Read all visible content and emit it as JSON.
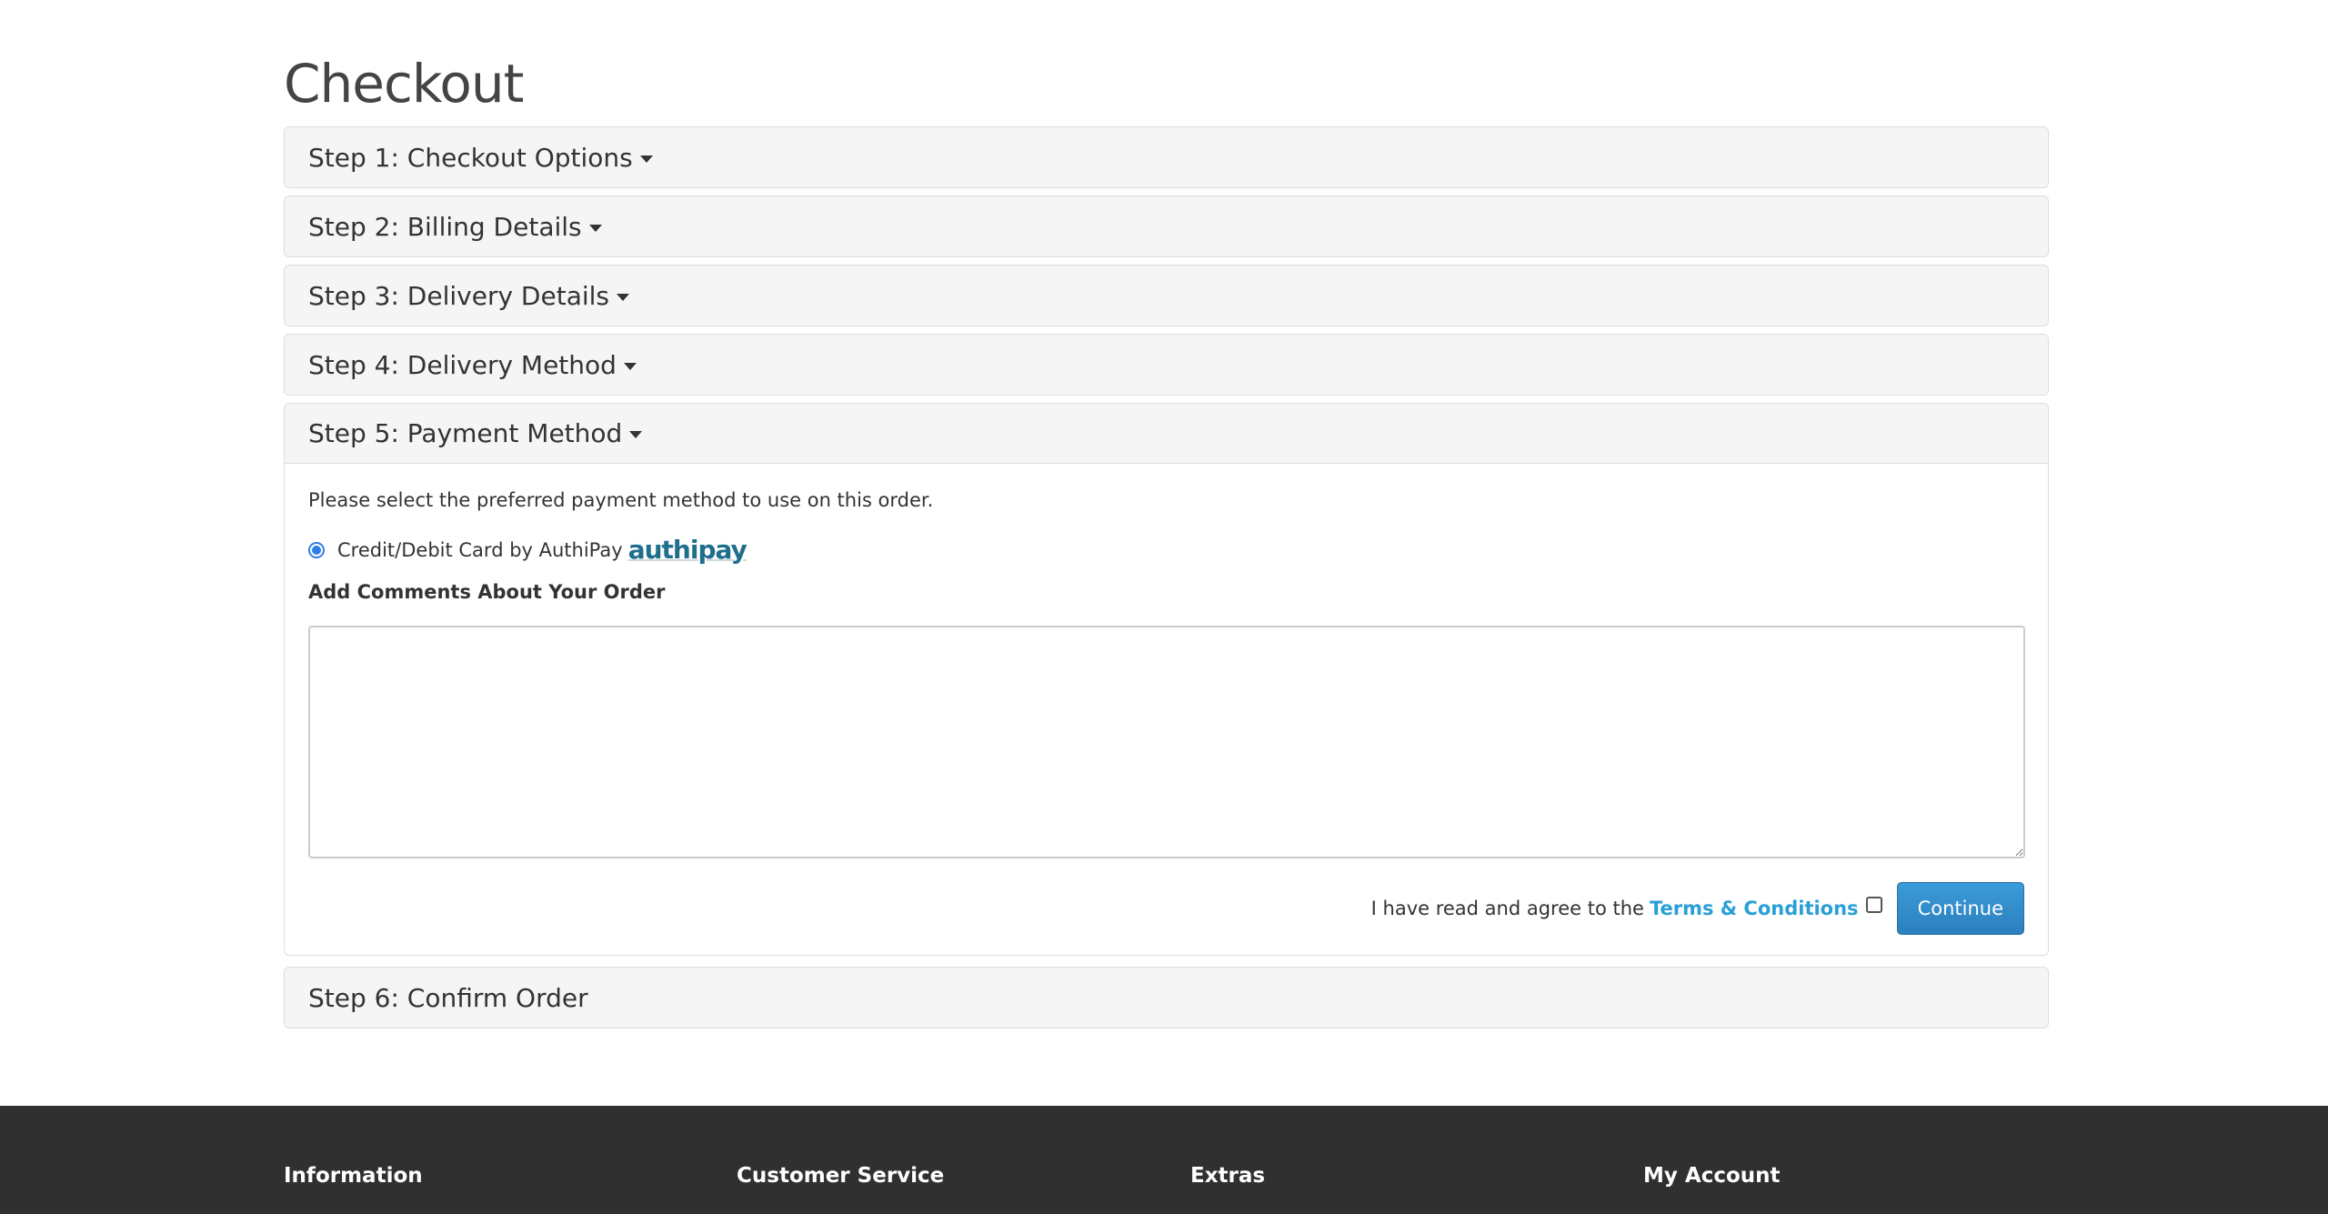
{
  "page": {
    "title": "Checkout"
  },
  "steps": [
    {
      "label": "Step 1: Checkout Options",
      "has_caret": true
    },
    {
      "label": "Step 2: Billing Details",
      "has_caret": true
    },
    {
      "label": "Step 3: Delivery Details",
      "has_caret": true
    },
    {
      "label": "Step 4: Delivery Method",
      "has_caret": true
    },
    {
      "label": "Step 5: Payment Method",
      "has_caret": true,
      "expanded": true
    },
    {
      "label": "Step 6: Confirm Order",
      "has_caret": false
    }
  ],
  "payment": {
    "intro": "Please select the preferred payment method to use on this order.",
    "method_label": "Credit/Debit Card by AuthiPay",
    "method_selected": true,
    "logo_text": "authipay",
    "comments_label": "Add Comments About Your Order",
    "comments_value": "",
    "agree_text": "I have read and agree to the",
    "terms_link": "Terms & Conditions",
    "agree_checked": false,
    "continue_button": "Continue"
  },
  "footer": {
    "columns": [
      "Information",
      "Customer Service",
      "Extras",
      "My Account"
    ]
  },
  "colors": {
    "accent": "#2a9fd6",
    "button": "#2b80be",
    "footer_bg": "#303030",
    "panel_bg": "#f5f5f5"
  }
}
